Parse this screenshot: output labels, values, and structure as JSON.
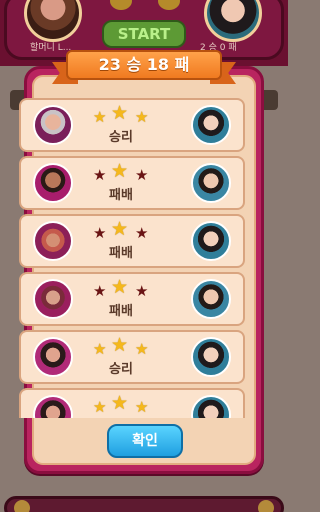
{
  "background": {
    "left_player_name": "할머니 L...",
    "right_player_name": "2 승 0 패",
    "start_label": "START"
  },
  "modal": {
    "title": "23 승 18 패",
    "confirm_label": "확인"
  },
  "rows": [
    {
      "result": "승리",
      "stars": [
        "gold",
        "gold",
        "gold"
      ],
      "left_avatar": "player-avatar-old-woman",
      "right_avatar": "opponent-avatar-woman"
    },
    {
      "result": "패배",
      "stars": [
        "dark",
        "gold",
        "dark"
      ],
      "left_avatar": "player-avatar-man",
      "right_avatar": "opponent-avatar-man"
    },
    {
      "result": "패배",
      "stars": [
        "dark",
        "gold",
        "dark"
      ],
      "left_avatar": "player-avatar-cowboy",
      "right_avatar": "opponent-avatar-woman"
    },
    {
      "result": "패배",
      "stars": [
        "dark",
        "gold",
        "dark"
      ],
      "left_avatar": "player-avatar-woman-cap",
      "right_avatar": "opponent-avatar-man"
    },
    {
      "result": "승리",
      "stars": [
        "gold",
        "gold",
        "gold"
      ],
      "left_avatar": "player-avatar-woman",
      "right_avatar": "opponent-avatar-woman"
    },
    {
      "result": "",
      "stars": [
        "gold",
        "gold",
        "gold"
      ],
      "left_avatar": "player-avatar-woman",
      "right_avatar": "opponent-avatar-woman"
    }
  ],
  "colors": {
    "modal_border": "#b9245f",
    "ribbon": "#f07a20",
    "confirm": "#1f9fe0",
    "star_gold": "#f5b81c",
    "star_dark": "#6a1414"
  }
}
